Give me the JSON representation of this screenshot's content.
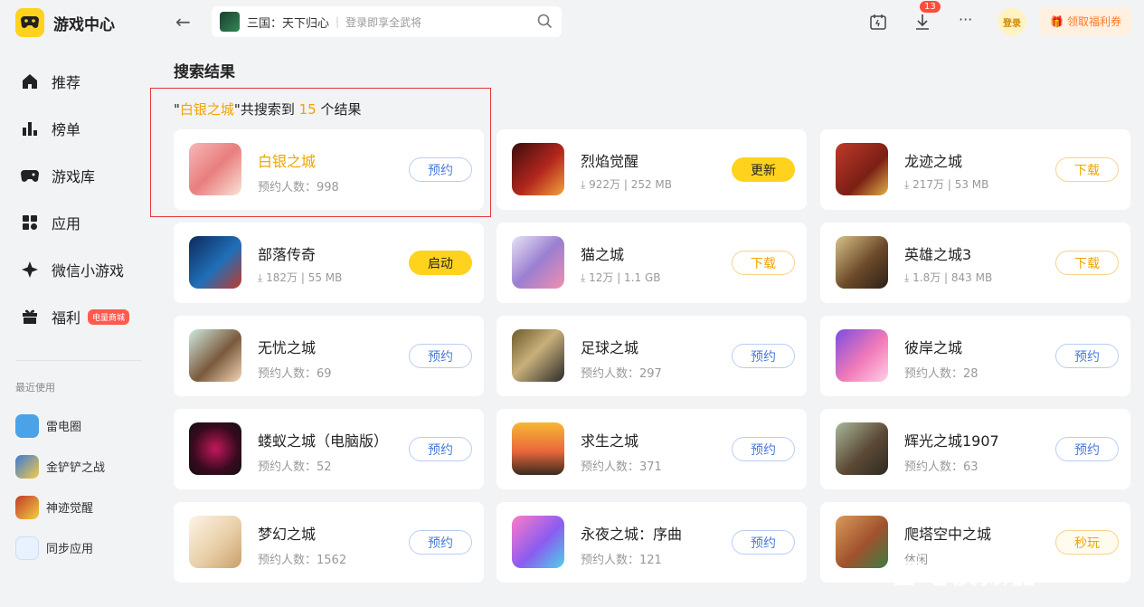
{
  "app": {
    "title": "游戏中心"
  },
  "nav": [
    {
      "label": "推荐"
    },
    {
      "label": "榜单"
    },
    {
      "label": "游戏库"
    },
    {
      "label": "应用"
    },
    {
      "label": "微信小游戏"
    },
    {
      "label": "福利",
      "badge": "电量商城"
    }
  ],
  "recent": {
    "title": "最近使用",
    "items": [
      {
        "label": "雷电圈"
      },
      {
        "label": "金铲铲之战"
      },
      {
        "label": "神迹觉醒"
      },
      {
        "label": "同步应用"
      }
    ]
  },
  "search": {
    "query": "三国：天下归心",
    "placeholder": "登录即享全武将"
  },
  "topbar": {
    "download_count": "13",
    "login_label": "登录",
    "welfare_label": "领取福利券"
  },
  "results": {
    "title": "搜索结果",
    "quote_open": "\"",
    "keyword": "白银之城",
    "middle": "\"共搜索到",
    "count": "15",
    "suffix": "个结果"
  },
  "games": [
    {
      "name": "白银之城",
      "meta": "预约人数：998",
      "button": "预约"
    },
    {
      "name": "烈焰觉醒",
      "meta": "⤓ 922万 | 252 MB",
      "button": "更新"
    },
    {
      "name": "龙迹之城",
      "meta": "⤓ 217万 | 53 MB",
      "button": "下载"
    },
    {
      "name": "部落传奇",
      "meta": "⤓ 182万 | 55 MB",
      "button": "启动"
    },
    {
      "name": "猫之城",
      "meta": "⤓ 12万 | 1.1 GB",
      "button": "下载"
    },
    {
      "name": "英雄之城3",
      "meta": "⤓ 1.8万 | 843 MB",
      "button": "下载"
    },
    {
      "name": "无忧之城",
      "meta": "预约人数：69",
      "button": "预约"
    },
    {
      "name": "足球之城",
      "meta": "预约人数：297",
      "button": "预约"
    },
    {
      "name": "彼岸之城",
      "meta": "预约人数：28",
      "button": "预约"
    },
    {
      "name": "蝼蚁之城（电脑版）",
      "meta": "预约人数：52",
      "button": "预约"
    },
    {
      "name": "求生之城",
      "meta": "预约人数：371",
      "button": "预约"
    },
    {
      "name": "辉光之城1907",
      "meta": "预约人数：63",
      "button": "预约"
    },
    {
      "name": "梦幻之城",
      "meta": "预约人数：1562",
      "button": "预约"
    },
    {
      "name": "永夜之城：序曲",
      "meta": "预约人数：121",
      "button": "预约"
    },
    {
      "name": "爬塔空中之城",
      "meta": "休闲",
      "button": "秒玩"
    }
  ],
  "watermark": "雷电模拟器",
  "colors": {
    "accent": "#ffd21e",
    "highlight": "#f0a400",
    "reserve": "#4a7ad8",
    "frame": "#e5383b"
  }
}
